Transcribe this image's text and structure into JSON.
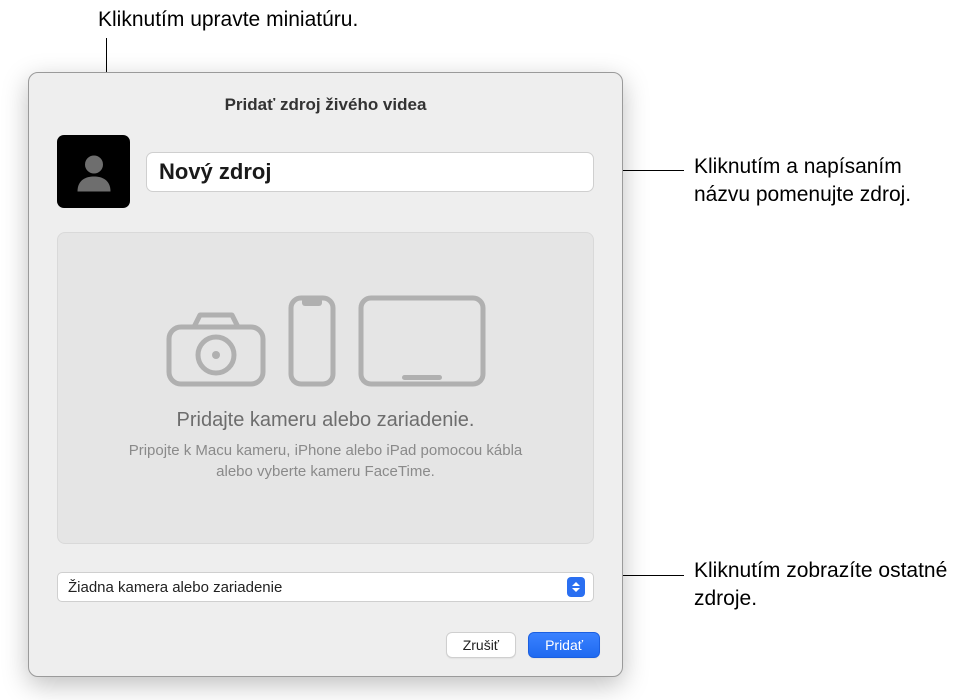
{
  "callouts": {
    "thumbnail": "Kliknutím upravte miniatúru.",
    "name": "Kliknutím a napísaním názvu pomenujte zdroj.",
    "sources": "Kliknutím zobrazíte ostatné zdroje."
  },
  "dialog": {
    "title": "Pridať zdroj živého videa",
    "name_value": "Nový zdroj",
    "preview": {
      "heading": "Pridajte kameru alebo zariadenie.",
      "sub": "Pripojte k Macu kameru, iPhone alebo iPad pomocou kábla alebo vyberte kameru FaceTime."
    },
    "select": {
      "selected": "Žiadna kamera alebo zariadenie"
    },
    "buttons": {
      "cancel": "Zrušiť",
      "add": "Pridať"
    }
  }
}
